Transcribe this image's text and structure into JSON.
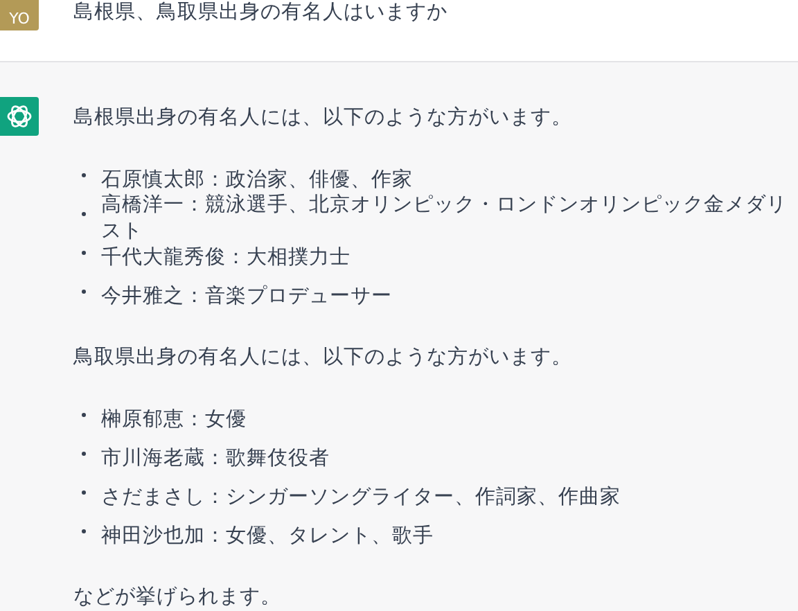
{
  "user_message": {
    "avatar": "YO",
    "text": "島根県、鳥取県出身の有名人はいますか"
  },
  "assistant_message": {
    "blocks": [
      {
        "kind": "paragraph",
        "text": "島根県出身の有名人には、以下のような方がいます。"
      },
      {
        "kind": "list",
        "items": [
          "石原慎太郎：政治家、俳優、作家",
          "高橋洋一：競泳選手、北京オリンピック・ロンドンオリンピック金メダリスト",
          "千代大龍秀俊：大相撲力士",
          "今井雅之：音楽プロデューサー"
        ]
      },
      {
        "kind": "paragraph",
        "text": "鳥取県出身の有名人には、以下のような方がいます。"
      },
      {
        "kind": "list",
        "items": [
          "榊原郁恵：女優",
          "市川海老蔵：歌舞伎役者",
          "さだまさし：シンガーソングライター、作詞家、作曲家",
          "神田沙也加：女優、タレント、歌手"
        ]
      },
      {
        "kind": "paragraph",
        "text": "などが挙げられます。"
      }
    ]
  }
}
